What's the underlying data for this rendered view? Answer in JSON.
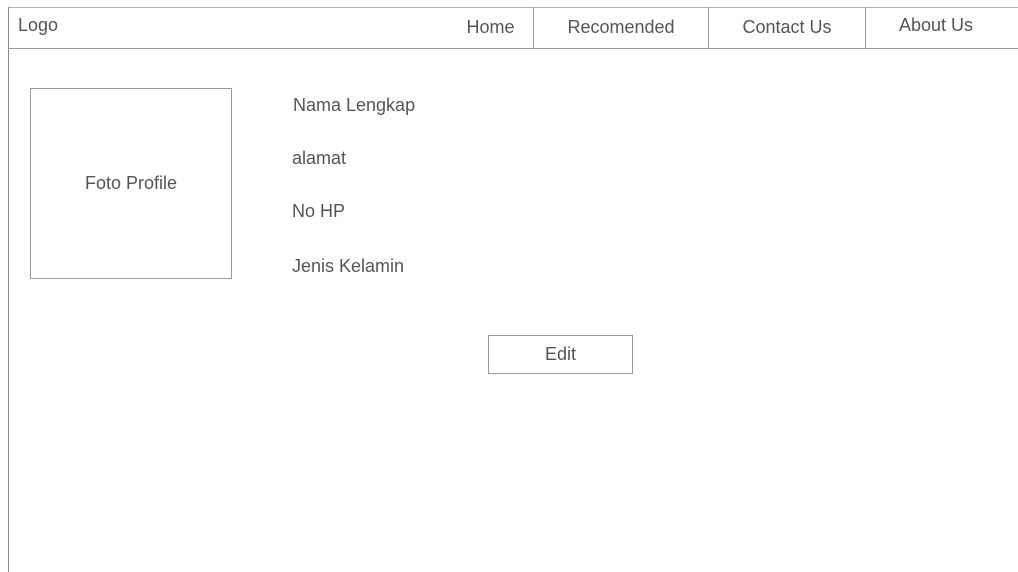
{
  "header": {
    "logo": "Logo",
    "nav": [
      {
        "label": "Home"
      },
      {
        "label": "Recomended"
      },
      {
        "label": "Contact Us"
      },
      {
        "label": "About Us"
      }
    ]
  },
  "profile": {
    "photo_label": "Foto Profile",
    "fields": [
      {
        "label": "Nama Lengkap"
      },
      {
        "label": "alamat"
      },
      {
        "label": "No HP"
      },
      {
        "label": "Jenis Kelamin"
      }
    ],
    "edit_label": "Edit"
  }
}
